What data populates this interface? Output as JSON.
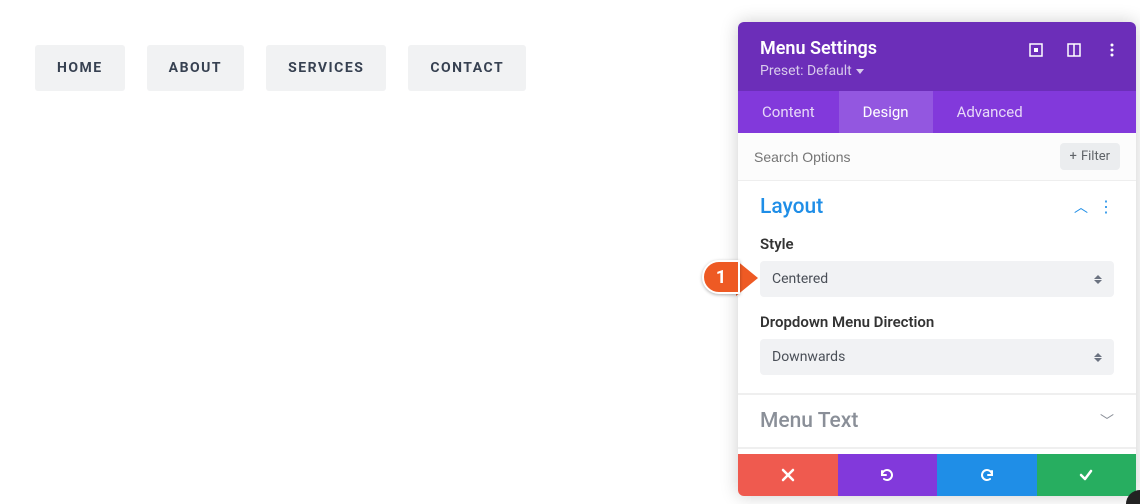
{
  "menu": {
    "items": [
      "HOME",
      "ABOUT",
      "SERVICES",
      "CONTACT"
    ]
  },
  "panel": {
    "title": "Menu Settings",
    "preset_label": "Preset: Default"
  },
  "tabs": {
    "content": "Content",
    "design": "Design",
    "advanced": "Advanced"
  },
  "search": {
    "placeholder": "Search Options",
    "filter_label": "Filter"
  },
  "sections": {
    "layout": {
      "title": "Layout",
      "style_label": "Style",
      "style_value": "Centered",
      "direction_label": "Dropdown Menu Direction",
      "direction_value": "Downwards"
    },
    "menu_text": {
      "title": "Menu Text"
    }
  },
  "marker": {
    "number": "1"
  }
}
